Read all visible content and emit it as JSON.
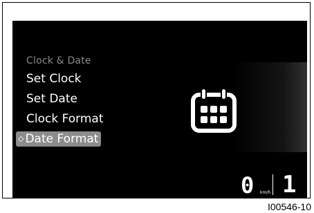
{
  "menu": {
    "title": "Clock & Date",
    "items": [
      {
        "label": "Set Clock"
      },
      {
        "label": "Set Date"
      },
      {
        "label": "Clock Format"
      },
      {
        "label": "Date Format",
        "selected": true
      }
    ],
    "selection_marker": "◇"
  },
  "status": {
    "speed": "0",
    "speed_unit": "km/h",
    "gear": "1"
  },
  "figure_code": "I00546-10",
  "icon": {
    "name": "calendar-icon"
  },
  "colors": {
    "screen_background": "#000000",
    "text": "#ffffff",
    "title_text": "#8a8a8a",
    "selection_highlight": "#8c8c8c"
  }
}
